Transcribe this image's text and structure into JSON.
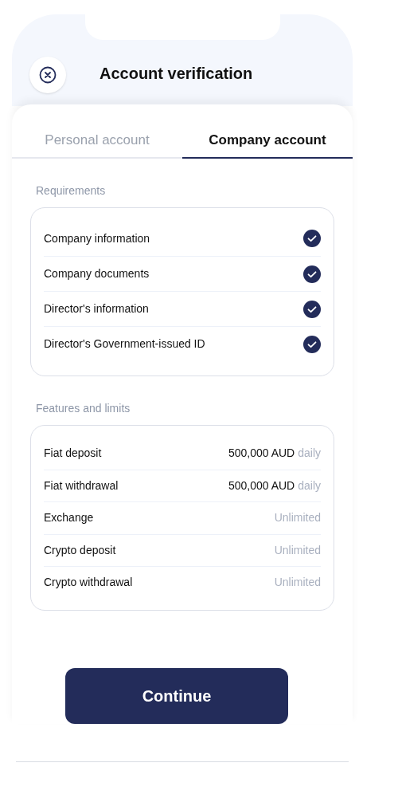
{
  "header": {
    "title": "Account verification"
  },
  "tabs": [
    {
      "label": "Personal account",
      "selected": false
    },
    {
      "label": "Company account",
      "selected": true
    }
  ],
  "requirements": {
    "heading": "Requirements",
    "items": [
      {
        "label": "Company information",
        "checked": true
      },
      {
        "label": "Company documents",
        "checked": true
      },
      {
        "label": "Director's information",
        "checked": true
      },
      {
        "label": "Director's Government-issued ID",
        "checked": true
      }
    ]
  },
  "limits": {
    "heading": "Features and limits",
    "items": [
      {
        "label": "Fiat deposit",
        "value": "500,000 AUD",
        "note": "daily"
      },
      {
        "label": "Fiat withdrawal",
        "value": "500,000 AUD",
        "note": "daily"
      },
      {
        "label": "Exchange",
        "note": "Unlimited"
      },
      {
        "label": "Crypto deposit",
        "note": "Unlimited"
      },
      {
        "label": "Crypto withdrawal",
        "note": "Unlimited"
      }
    ]
  },
  "button": {
    "label": "Continue"
  }
}
